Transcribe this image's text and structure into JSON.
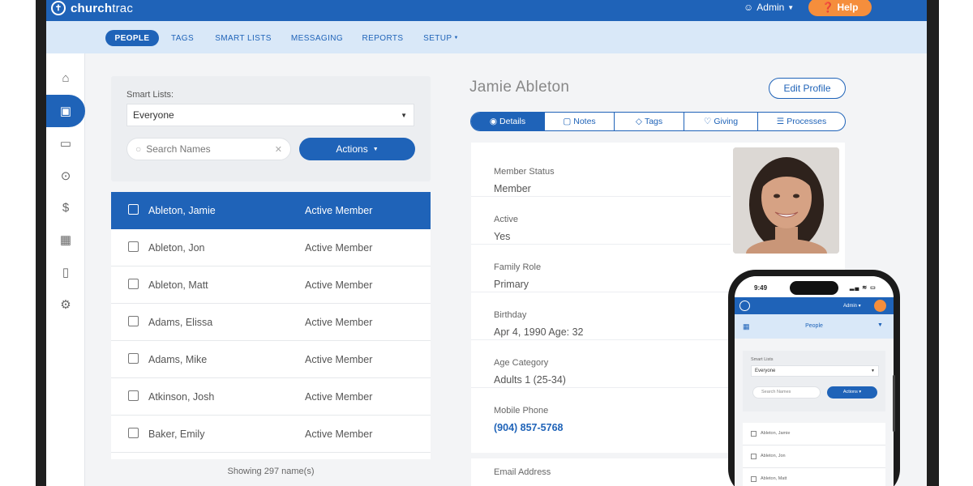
{
  "app": {
    "logo_icon": "church-logo-icon",
    "logo_prefix": "church",
    "logo_suffix": "trac",
    "admin_label": "Admin",
    "help_label": "Help"
  },
  "nav": {
    "tabs": [
      {
        "label": "PEOPLE",
        "active": true
      },
      {
        "label": "TAGS",
        "active": false
      },
      {
        "label": "SMART LISTS",
        "active": false
      },
      {
        "label": "MESSAGING",
        "active": false
      },
      {
        "label": "REPORTS",
        "active": false
      },
      {
        "label": "SETUP",
        "active": false
      }
    ]
  },
  "rail": {
    "icons": [
      "home-icon",
      "people-card-icon",
      "calendar-icon",
      "chevron-up-circle-icon",
      "giving-icon",
      "grid-icon",
      "mobile-icon",
      "gear-icon"
    ],
    "active_index": 1
  },
  "filters": {
    "smart_lists_label": "Smart Lists:",
    "smart_list_value": "Everyone",
    "search_placeholder": "Search Names",
    "actions_label": "Actions"
  },
  "people": [
    {
      "name": "Ableton, Jamie",
      "status": "Active Member",
      "selected": true
    },
    {
      "name": "Ableton, Jon",
      "status": "Active Member",
      "selected": false
    },
    {
      "name": "Ableton, Matt",
      "status": "Active Member",
      "selected": false
    },
    {
      "name": "Adams, Elissa",
      "status": "Active Member",
      "selected": false
    },
    {
      "name": "Adams, Mike",
      "status": "Active Member",
      "selected": false
    },
    {
      "name": "Atkinson, Josh",
      "status": "Active Member",
      "selected": false
    },
    {
      "name": "Baker, Emily",
      "status": "Active Member",
      "selected": false
    }
  ],
  "showing_text": "Showing 297 name(s)",
  "detail": {
    "person_name": "Jamie Ableton",
    "edit_label": "Edit Profile",
    "tabs": [
      {
        "label": "Details",
        "icon": "details-icon",
        "active": true
      },
      {
        "label": "Notes",
        "icon": "notes-icon",
        "active": false
      },
      {
        "label": "Tags",
        "icon": "tag-icon",
        "active": false
      },
      {
        "label": "Giving",
        "icon": "giving-icon",
        "active": false
      },
      {
        "label": "Processes",
        "icon": "list-icon",
        "active": false
      }
    ],
    "fields": [
      {
        "label": "Member Status",
        "value": "Member"
      },
      {
        "label": "Active",
        "value": "Yes"
      },
      {
        "label": "Family Role",
        "value": "Primary"
      },
      {
        "label": "Birthday",
        "value": "Apr 4, 1990 Age: 32"
      },
      {
        "label": "Age Category",
        "value": "Adults 1 (25-34)"
      },
      {
        "label": "Mobile Phone",
        "value": "(904) 857-5768",
        "link": true
      }
    ],
    "email_label": "Email Address"
  },
  "phone": {
    "time": "9:49",
    "admin_label": "Admin",
    "nav_title": "People",
    "smart_list_label": "Smart Lists",
    "smart_list_value": "Everyone",
    "search_placeholder": "Search Names",
    "actions_label": "Actions",
    "people": [
      "Ableton, Jamie",
      "Ableton, Jon",
      "Ableton, Matt"
    ]
  },
  "colors": {
    "brand_blue": "#1f63b8",
    "nav_bg": "#d9e8f8",
    "help_orange": "#f58e3c"
  }
}
